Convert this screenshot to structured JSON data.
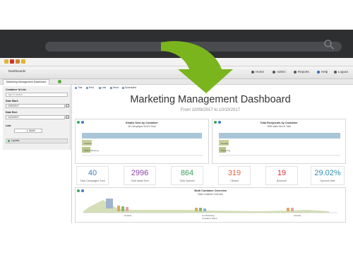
{
  "header": {
    "title": "Dashboards",
    "links": [
      "Home",
      "Admin",
      "Reports",
      "Help",
      "Logout"
    ]
  },
  "tab": {
    "label": "Marketing Management Dashboard"
  },
  "sidebar": {
    "list_label": "Container Id List:",
    "list_placeholder": "Type to search...",
    "start_label": "Date Start:",
    "start_value": "10/09/2017",
    "end_label": "Date End:",
    "end_value": "10/10/2017",
    "last_label": "Last",
    "last_value": "Month",
    "update_label": "Update"
  },
  "toolbar": {
    "buttons": [
      "Tide",
      "Print",
      "Link",
      "Send",
      "Scheduled"
    ]
  },
  "dashboard": {
    "title": "Marketing Management Dashboard",
    "subtitle": "From 10/09/2017 to 10/10/2017"
  },
  "panels": {
    "left": {
      "title": "Emails Sent by Container",
      "subtitle": "All Campaigns Sent in Total",
      "bars": [
        "Outside",
        "SMS Marketing"
      ]
    },
    "right": {
      "title": "Total Recipients by Container",
      "subtitle": "2996 Mails Sent in Total",
      "bars": [
        "Outside",
        "Marketing"
      ]
    },
    "bottom": {
      "title": "Multi Container Overview",
      "subtitle": "Multi Container Overview",
      "groups": [
        "Outside",
        "Un Marketing",
        "Outside"
      ],
      "xlabel": "Container Name"
    }
  },
  "kpis": [
    {
      "value": "40",
      "label": "Total Campaigns Sent",
      "color": "#3d7fc1"
    },
    {
      "value": "2996",
      "label": "Total Mails Sent",
      "color": "#8e44ad"
    },
    {
      "value": "864",
      "label": "Total Opened",
      "color": "#3aa55a"
    },
    {
      "value": "319",
      "label": "Clicked",
      "color": "#e0653a"
    },
    {
      "value": "19",
      "label": "Bounced",
      "color": "#d9303a"
    },
    {
      "value": "29.02%",
      "label": "Opened Rate",
      "color": "#2f8fb4"
    }
  ],
  "colors": {
    "arrow": "#7ab51d",
    "browser_chrome": "#2e2f31"
  }
}
